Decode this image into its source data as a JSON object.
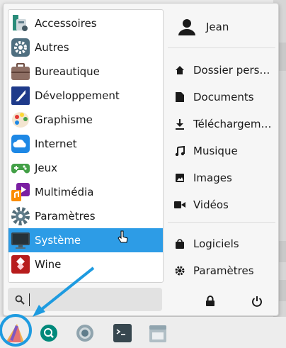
{
  "categories": [
    {
      "label": "Accessoires",
      "icon": "accessories-icon"
    },
    {
      "label": "Autres",
      "icon": "gear-icon"
    },
    {
      "label": "Bureautique",
      "icon": "briefcase-icon"
    },
    {
      "label": "Développement",
      "icon": "development-icon"
    },
    {
      "label": "Graphisme",
      "icon": "palette-icon"
    },
    {
      "label": "Internet",
      "icon": "cloud-icon"
    },
    {
      "label": "Jeux",
      "icon": "gamepad-icon"
    },
    {
      "label": "Multimédia",
      "icon": "multimedia-icon"
    },
    {
      "label": "Paramètres",
      "icon": "settings-icon"
    },
    {
      "label": "Système",
      "icon": "monitor-icon"
    },
    {
      "label": "Wine",
      "icon": "wine-icon"
    }
  ],
  "selected_category": "Système",
  "search": {
    "value": ""
  },
  "user": {
    "name": "Jean"
  },
  "places": [
    {
      "label": "Dossier pers…",
      "icon": "home-icon"
    },
    {
      "label": "Documents",
      "icon": "document-icon"
    },
    {
      "label": "Téléchargem…",
      "icon": "download-icon"
    },
    {
      "label": "Musique",
      "icon": "music-icon"
    },
    {
      "label": "Images",
      "icon": "image-icon"
    },
    {
      "label": "Vidéos",
      "icon": "video-icon"
    }
  ],
  "system_items": [
    {
      "label": "Logiciels",
      "icon": "software-bag-icon"
    },
    {
      "label": "Paramètres",
      "icon": "settings-gear-icon"
    }
  ],
  "actions": {
    "lock": "lock-icon",
    "power": "power-icon"
  },
  "taskbar": [
    "app-menu-icon",
    "search-app-icon",
    "browser-icon",
    "terminal-icon",
    "file-manager-icon"
  ],
  "colors": {
    "selection": "#2d9ce6",
    "annotation": "#1e9be0"
  }
}
